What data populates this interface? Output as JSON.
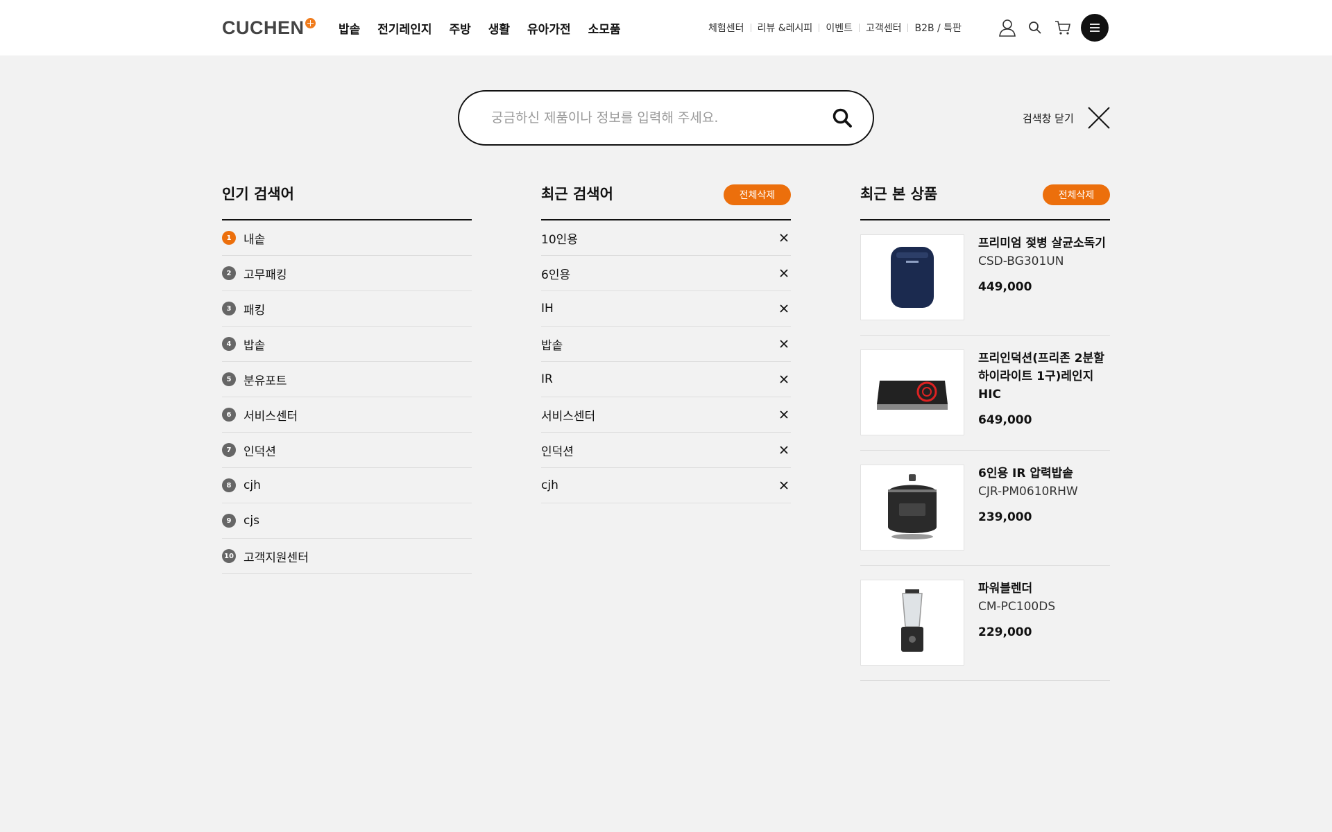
{
  "header": {
    "logo_text": "CUCHEN",
    "nav": [
      "밥솥",
      "전기레인지",
      "주방",
      "생활",
      "유아가전",
      "소모품"
    ],
    "util_links": [
      "체험센터",
      "리뷰 &레시피",
      "이벤트",
      "고객센터",
      "B2B / 특판"
    ]
  },
  "search": {
    "placeholder": "궁금하신 제품이나 정보를 입력해 주세요.",
    "value": "",
    "close_label": "검색창 닫기"
  },
  "popular": {
    "title": "인기 검색어",
    "items": [
      {
        "rank": "1",
        "text": "내솥"
      },
      {
        "rank": "2",
        "text": "고무패킹"
      },
      {
        "rank": "3",
        "text": "패킹"
      },
      {
        "rank": "4",
        "text": "밥솥"
      },
      {
        "rank": "5",
        "text": "분유포트"
      },
      {
        "rank": "6",
        "text": "서비스센터"
      },
      {
        "rank": "7",
        "text": "인덕션"
      },
      {
        "rank": "8",
        "text": "cjh"
      },
      {
        "rank": "9",
        "text": "cjs"
      },
      {
        "rank": "10",
        "text": "고객지원센터"
      }
    ]
  },
  "recent_search": {
    "title": "최근 검색어",
    "delete_all": "전체삭제",
    "items": [
      "10인용",
      "6인용",
      "IH",
      "밥솥",
      "IR",
      "서비스센터",
      "인덕션",
      "cjh"
    ]
  },
  "recent_products": {
    "title": "최근 본 상품",
    "delete_all": "전체삭제",
    "items": [
      {
        "name": "프리미엄 젖병 살균소독기",
        "model": "CSD-BG301UN",
        "price": "449,000"
      },
      {
        "name": "프리인덕션(프리존 2분할",
        "model": "하이라이트 1구)레인지HIC",
        "price": "649,000"
      },
      {
        "name": "6인용 IR 압력밥솥",
        "model": "CJR-PM0610RHW",
        "price": "239,000"
      },
      {
        "name": "파워블렌더",
        "model": "CM-PC100DS",
        "price": "229,000"
      }
    ]
  },
  "colors": {
    "accent": "#ec6f0c",
    "background": "#f2f2f2"
  }
}
